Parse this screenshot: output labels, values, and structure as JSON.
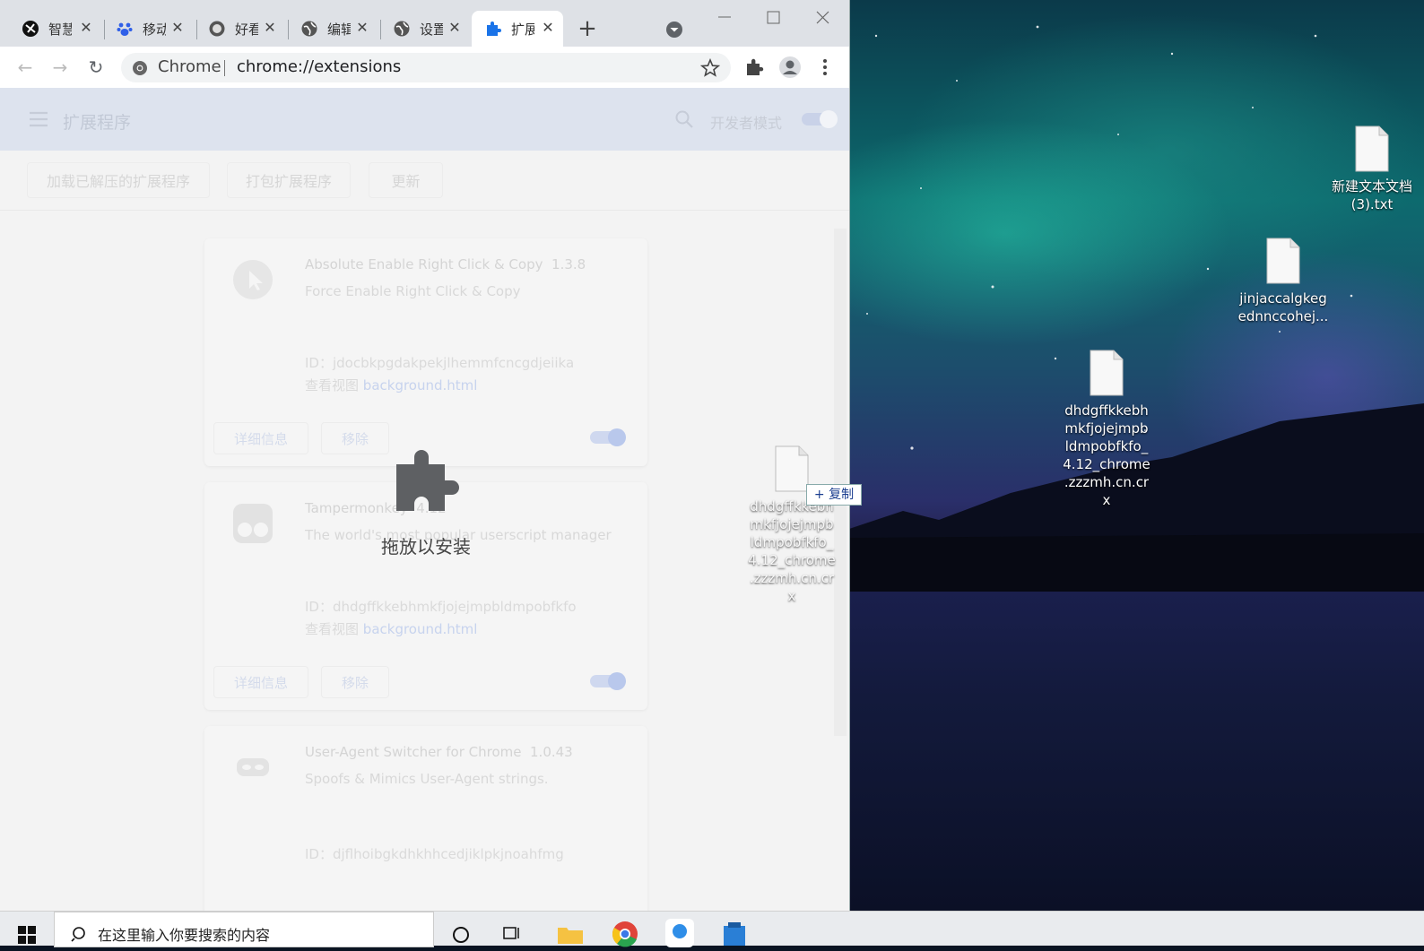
{
  "browser": {
    "tabs": [
      {
        "label": "智慧",
        "icon": "app-logo-icon"
      },
      {
        "label": "移动",
        "icon": "paw-icon"
      },
      {
        "label": "好看",
        "icon": "avatar-icon"
      },
      {
        "label": "编辑",
        "icon": "globe-icon"
      },
      {
        "label": "设置",
        "icon": "globe-icon"
      },
      {
        "label": "扩展",
        "icon": "puzzle-icon",
        "active": true
      }
    ],
    "new_tab": "+",
    "omnibox": {
      "site": "Chrome",
      "url": "chrome://extensions"
    }
  },
  "extensions_page": {
    "title": "扩展程序",
    "dev_mode_label": "开发者模式",
    "dev_mode_on": true,
    "actions": [
      "加载已解压的扩展程序",
      "打包扩展程序",
      "更新"
    ],
    "drop_overlay": "拖放以安装",
    "cards": [
      {
        "name": "Absolute Enable Right Click & Copy",
        "version": "1.3.8",
        "description": "Force Enable Right Click & Copy",
        "id_label": "ID：",
        "id": "jdocbkpgdakpekjlhemmfcncgdjeiika",
        "view_label": "查看视图",
        "view_link": "background.html",
        "details": "详细信息",
        "remove": "移除",
        "enabled": true
      },
      {
        "name": "Tampermonkey",
        "version": "4.12",
        "description": "The world's most popular userscript manager",
        "id_label": "ID：",
        "id": "dhdgffkkebhmkfjojejmpbldmpobfkfo",
        "view_label": "查看视图",
        "view_link": "background.html",
        "details": "详细信息",
        "remove": "移除",
        "enabled": true
      },
      {
        "name": "User-Agent Switcher for Chrome",
        "version": "1.0.43",
        "description": "Spoofs & Mimics User-Agent strings.",
        "id_label": "ID：",
        "id": "djflhoibgkdhkhhcedjiklpkjnoahfmg"
      }
    ]
  },
  "drag": {
    "filename_lines": [
      "dhdgffkkebh",
      "mkfjojejmpb",
      "ldmpobfkfo_",
      "4.12_chrome",
      ".zzzmh.cn.cr",
      "x"
    ],
    "copy_badge": "+ 复制"
  },
  "desktop_icons": [
    {
      "lines": [
        "新建文本文档",
        "(3).txt"
      ]
    },
    {
      "lines": [
        "jinjaccalgkeg",
        "ednnccohej..."
      ]
    },
    {
      "lines": [
        "dhdgffkkebh",
        "mkfjojejmpb",
        "ldmpobfkfo_",
        "4.12_chrome",
        ".zzzmh.cn.cr",
        "x"
      ]
    }
  ],
  "taskbar": {
    "search_placeholder": "在这里输入你要搜索的内容"
  }
}
